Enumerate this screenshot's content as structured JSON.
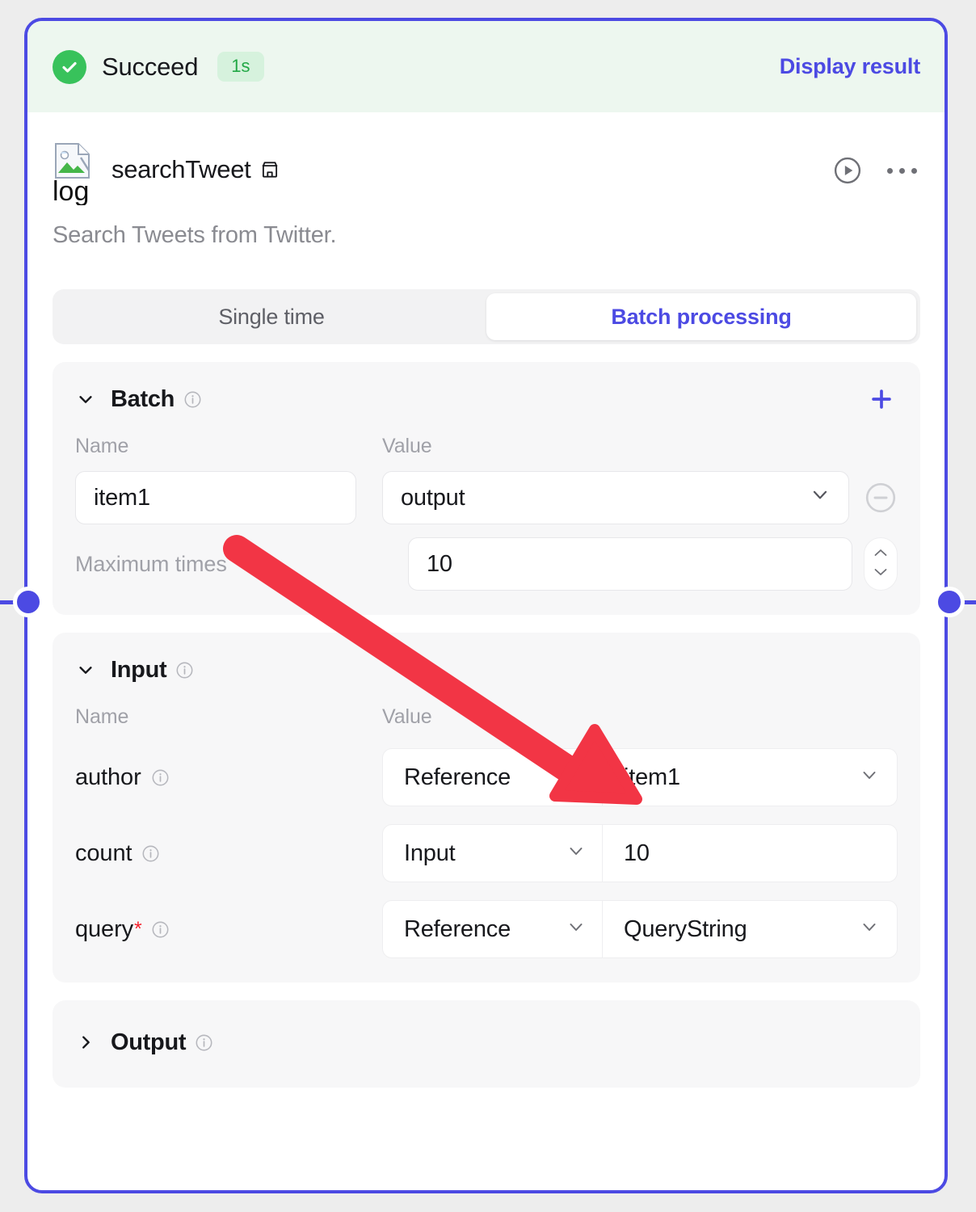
{
  "status": {
    "icon": "check-circle-icon",
    "label": "Succeed",
    "duration": "1s",
    "display_result_label": "Display result",
    "bg_color": "#edf7ef",
    "accent_color": "#38c25b",
    "link_color": "#4c4ae3"
  },
  "node": {
    "logo_alt": "log",
    "title": "searchTweet",
    "marketplace_icon": "store-icon",
    "run_icon": "play-circle-icon",
    "more_icon": "more-horizontal-icon",
    "description": "Search Tweets from Twitter.",
    "border_color": "#4c4ae3"
  },
  "tabs": {
    "items": [
      {
        "label": "Single time",
        "active": false
      },
      {
        "label": "Batch processing",
        "active": true
      }
    ]
  },
  "batch": {
    "title": "Batch",
    "info_icon": "info-circle-icon",
    "add_icon": "plus-icon",
    "columns": {
      "name": "Name",
      "value": "Value"
    },
    "row": {
      "name_value": "item1",
      "value_value": "output",
      "remove_icon": "minus-circle-icon"
    },
    "max_times": {
      "label": "Maximum times",
      "value": "10",
      "stepper_up_icon": "chevron-up-icon",
      "stepper_down_icon": "chevron-down-icon"
    }
  },
  "input": {
    "title": "Input",
    "info_icon": "info-circle-icon",
    "columns": {
      "name": "Name",
      "value": "Value"
    },
    "rows": [
      {
        "name": "author",
        "required": "",
        "type": "Reference",
        "value": "item1",
        "value_has_caret": true
      },
      {
        "name": "count",
        "required": "",
        "type": "Input",
        "value": "10",
        "value_has_caret": false
      },
      {
        "name": "query",
        "required": "*",
        "type": "Reference",
        "value": "QueryString",
        "value_has_caret": true
      }
    ]
  },
  "output": {
    "title": "Output",
    "info_icon": "info-circle-icon",
    "collapsed": true
  },
  "annotation": {
    "arrow_color": "#f23545",
    "from": "item1 batch name field",
    "to": "author reference value item1"
  }
}
